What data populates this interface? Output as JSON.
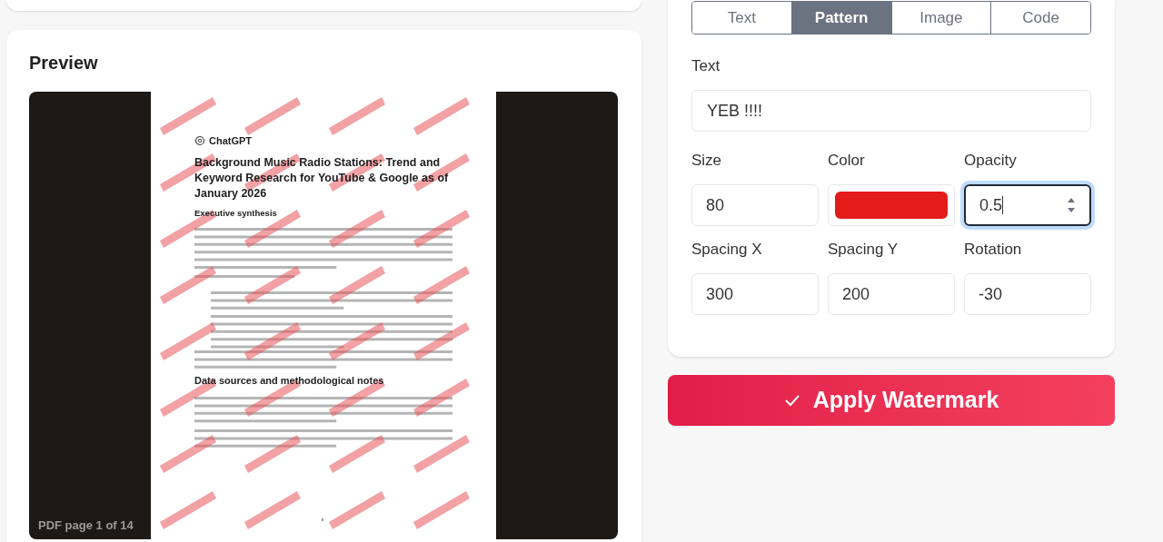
{
  "preview": {
    "title": "Preview",
    "page_label": "PDF page 1 of 14",
    "page": {
      "kind": "picture",
      "brand": "ChatGPT",
      "title": "Background Music Radio Stations: Trend and Keyword Research for YouTube & Google as of January 2026",
      "headings": [
        "Executive synthesis",
        "Data sources and methodological notes"
      ]
    }
  },
  "settings": {
    "tabs": [
      {
        "label": "Text",
        "selected": false
      },
      {
        "label": "Pattern",
        "selected": true
      },
      {
        "label": "Image",
        "selected": false
      },
      {
        "label": "Code",
        "selected": false
      }
    ],
    "text_label": "Text",
    "text_value": "YEB !!!!",
    "fields": [
      {
        "kind": "number",
        "label": "Size",
        "value": "80",
        "focused": false
      },
      {
        "kind": "color",
        "label": "Color",
        "color": "#e31b1b"
      },
      {
        "kind": "number",
        "label": "Opacity",
        "value": "0.5",
        "focused": true
      },
      {
        "kind": "number",
        "label": "Spacing X",
        "value": "300",
        "focused": false
      },
      {
        "kind": "number",
        "label": "Spacing Y",
        "value": "200",
        "focused": false
      },
      {
        "kind": "number",
        "label": "Rotation",
        "value": "-30",
        "focused": false
      }
    ]
  },
  "apply_button": "Apply Watermark"
}
